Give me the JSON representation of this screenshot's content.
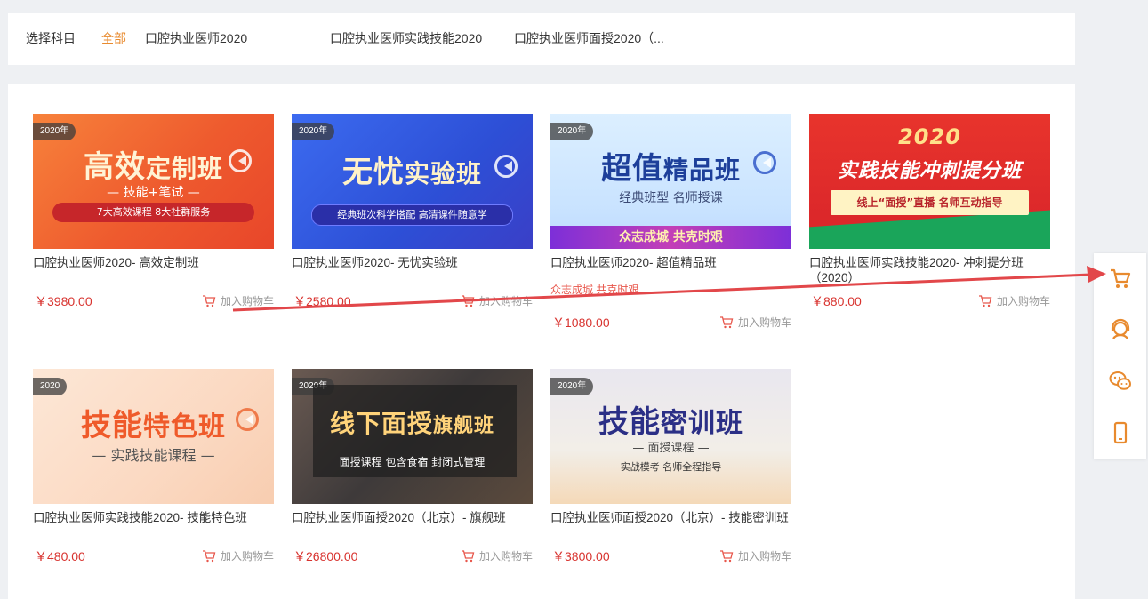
{
  "subject_filter": {
    "label": "选择科目",
    "items": [
      {
        "label": "全部",
        "active": true
      },
      {
        "label": "口腔执业医师2020",
        "active": false
      },
      {
        "label": "口腔执业医师实践技能2020",
        "active": false
      },
      {
        "label": "口腔执业医师面授2020（...",
        "active": false
      }
    ]
  },
  "add_to_cart_label": "加入购物车",
  "products": [
    {
      "title": "口腔执业医师2020- 高效定制班",
      "desc": "",
      "price": "￥3980.00",
      "banner": {
        "year": "2020年",
        "title_a": "高效",
        "title_b": "定制班",
        "sub": "— 技能+笔试 —",
        "pill": "7大高效课程   8大社群服务"
      }
    },
    {
      "title": "口腔执业医师2020- 无忧实验班",
      "desc": "",
      "price": "￥2580.00",
      "banner": {
        "year": "2020年",
        "title_a": "无忧",
        "title_b": "实验班",
        "sub": "",
        "pill": "经典班次科学搭配  高清课件随意学"
      }
    },
    {
      "title": "口腔执业医师2020- 超值精品班",
      "desc": "众志成城 共克时艰",
      "price": "￥1080.00",
      "banner": {
        "year": "2020年",
        "title_a": "超值",
        "title_b": "精品班",
        "sub": "经典班型   名师授课",
        "pill": "众志成城   共克时艰"
      }
    },
    {
      "title": "口腔执业医师实践技能2020- 冲刺提分班（2020）",
      "desc": "",
      "price": "￥880.00",
      "banner": {
        "year": "2020",
        "title_a": "实践技能",
        "title_b": "冲刺提分班",
        "sub": "",
        "pill": "线上“面授”直播   名师互动指导"
      }
    },
    {
      "title": "口腔执业医师实践技能2020- 技能特色班",
      "desc": "",
      "price": "￥480.00",
      "banner": {
        "year": "2020",
        "title_a": "技能",
        "title_b": "特色班",
        "sub": "— 实践技能课程 —",
        "pill": ""
      }
    },
    {
      "title": "口腔执业医师面授2020（北京）- 旗舰班",
      "desc": "",
      "price": "￥26800.00",
      "banner": {
        "year": "2020年",
        "title_a": "线下面授",
        "title_b": "旗舰班",
        "sub": "面授课程 包含食宿 封闭式管理",
        "pill": ""
      }
    },
    {
      "title": "口腔执业医师面授2020（北京）- 技能密训班",
      "desc": "",
      "price": "￥3800.00",
      "banner": {
        "year": "2020年",
        "title_a": "技能",
        "title_b": "密训班",
        "sub": "— 面授课程 —",
        "pill": "实战模考  名师全程指导"
      }
    }
  ],
  "sidebar_icons": [
    "cart-icon",
    "customer-service-icon",
    "wechat-icon",
    "mobile-icon"
  ],
  "colors": {
    "accent": "#e88a2e",
    "price": "#d8332f",
    "annotation_arrow": "#e2474a"
  }
}
